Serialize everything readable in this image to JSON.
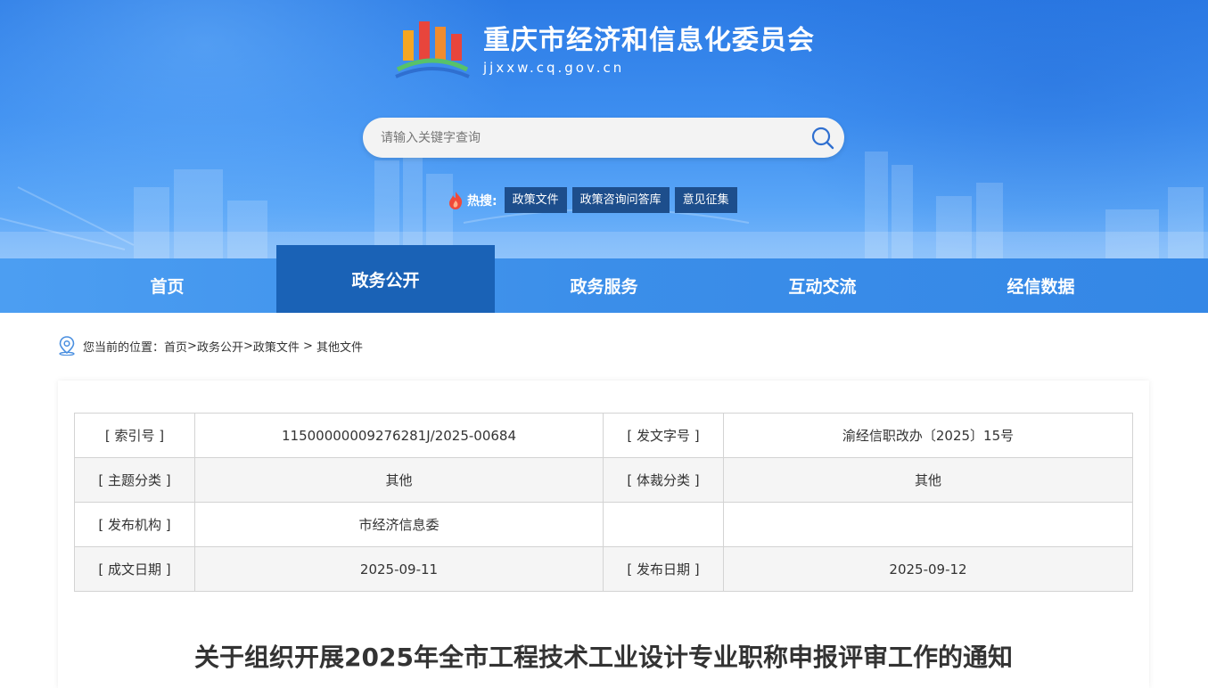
{
  "site": {
    "title": "重庆市经济和信息化委员会",
    "url": "jjxxw.cq.gov.cn"
  },
  "search": {
    "placeholder": "请输入关键字查询"
  },
  "hot": {
    "label": "热搜:",
    "tags": [
      "政策文件",
      "政策咨询问答库",
      "意见征集"
    ]
  },
  "nav": {
    "items": [
      "首页",
      "政务公开",
      "政务服务",
      "互动交流",
      "经信数据"
    ],
    "active": "政务公开"
  },
  "breadcrumb": {
    "prefix": "您当前的位置：",
    "path": [
      "首页",
      "政务公开",
      "政策文件",
      "其他文件"
    ]
  },
  "meta": {
    "rows": [
      {
        "l1": "[ 索引号 ]",
        "v1": "11500000009276281J/2025-00684",
        "l2": "[ 发文字号 ]",
        "v2": "渝经信职改办〔2025〕15号"
      },
      {
        "l1": "[ 主题分类 ]",
        "v1": "其他",
        "l2": "[ 体裁分类 ]",
        "v2": "其他"
      },
      {
        "l1": "[ 发布机构 ]",
        "v1": "市经济信息委",
        "l2": "",
        "v2": ""
      },
      {
        "l1": "[ 成文日期 ]",
        "v1": "2025-09-11",
        "l2": "[ 发布日期 ]",
        "v2": "2025-09-12"
      }
    ]
  },
  "document": {
    "title": "关于组织开展2025年全市工程技术工业设计专业职称申报评审工作的通知"
  },
  "colors": {
    "banner_blue": "#2c7be5",
    "nav_active": "#1a62b6",
    "hot_tag_bg": "#1d4e8c"
  }
}
